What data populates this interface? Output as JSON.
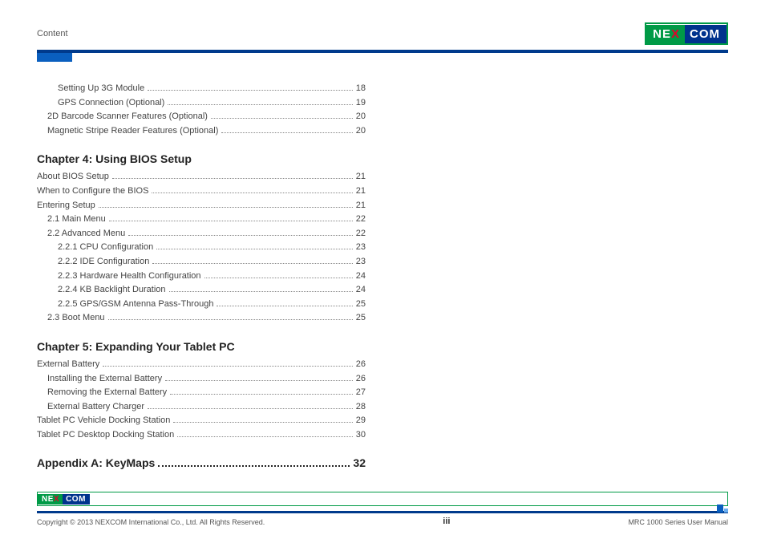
{
  "header": {
    "section_label": "Content",
    "logo_text_left": "NE",
    "logo_text_x": "X",
    "logo_text_right": "COM"
  },
  "toc_pre": [
    {
      "label": "Setting Up 3G Module",
      "page": "18",
      "level": 2
    },
    {
      "label": "GPS Connection (Optional)",
      "page": "19",
      "level": 2
    },
    {
      "label": "2D Barcode Scanner Features (Optional)",
      "page": "20",
      "level": 1
    },
    {
      "label": "Magnetic Stripe Reader Features (Optional)",
      "page": "20",
      "level": 1
    }
  ],
  "chapter4": {
    "title": "Chapter 4: Using BIOS Setup",
    "rows": [
      {
        "label": "About BIOS Setup",
        "page": "21",
        "level": 0
      },
      {
        "label": "When to Configure the BIOS",
        "page": "21",
        "level": 0
      },
      {
        "label": "Entering Setup",
        "page": "21",
        "level": 0
      },
      {
        "label": "2.1 Main Menu",
        "page": "22",
        "level": 1
      },
      {
        "label": "2.2 Advanced Menu",
        "page": "22",
        "level": 1
      },
      {
        "label": "2.2.1 CPU Configuration",
        "page": "23",
        "level": 2
      },
      {
        "label": "2.2.2 IDE Configuration",
        "page": "23",
        "level": 2
      },
      {
        "label": "2.2.3 Hardware Health Configuration",
        "page": "24",
        "level": 2
      },
      {
        "label": "2.2.4 KB Backlight Duration",
        "page": "24",
        "level": 2
      },
      {
        "label": "2.2.5 GPS/GSM Antenna Pass-Through",
        "page": "25",
        "level": 2
      },
      {
        "label": "2.3 Boot Menu",
        "page": "25",
        "level": 1
      }
    ]
  },
  "chapter5": {
    "title": "Chapter 5: Expanding Your Tablet PC",
    "rows": [
      {
        "label": "External Battery",
        "page": "26",
        "level": 0
      },
      {
        "label": "Installing the External Battery",
        "page": "26",
        "level": 1
      },
      {
        "label": "Removing the External Battery",
        "page": "27",
        "level": 1
      },
      {
        "label": "External Battery Charger",
        "page": "28",
        "level": 1
      },
      {
        "label": "Tablet PC Vehicle Docking Station",
        "page": "29",
        "level": 0
      },
      {
        "label": "Tablet PC Desktop Docking Station",
        "page": "30",
        "level": 0
      }
    ]
  },
  "appendix": {
    "label": "Appendix A: KeyMaps",
    "page": "32"
  },
  "footer": {
    "copyright": "Copyright © 2013 NEXCOM International Co., Ltd. All Rights Reserved.",
    "page_num": "iii",
    "manual": "MRC 1000 Series User Manual"
  }
}
